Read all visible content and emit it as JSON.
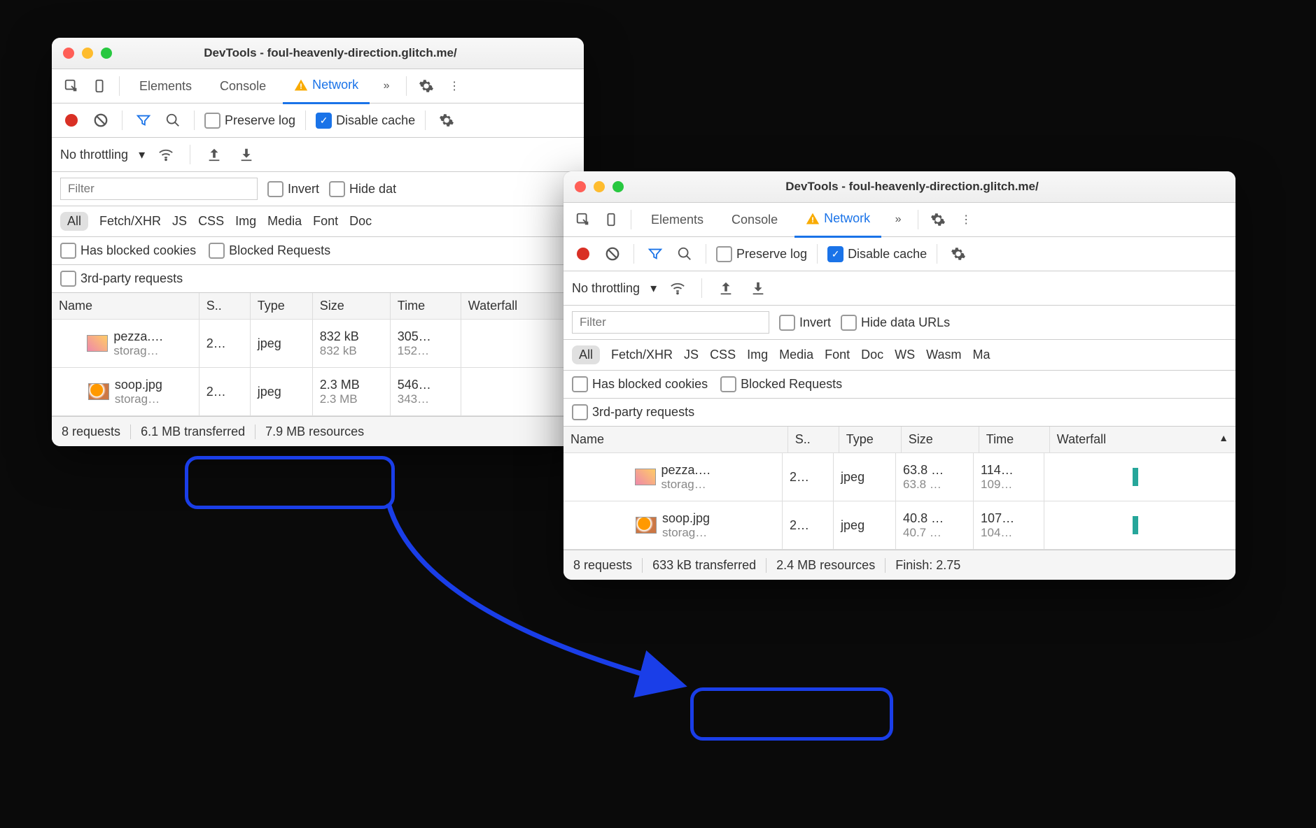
{
  "win1": {
    "title": "DevTools - foul-heavenly-direction.glitch.me/",
    "tabs": {
      "elements": "Elements",
      "console": "Console",
      "network": "Network"
    },
    "preserve_log": "Preserve log",
    "disable_cache": "Disable cache",
    "no_throttling": "No throttling",
    "filter_placeholder": "Filter",
    "invert": "Invert",
    "hide_data": "Hide dat",
    "types": {
      "all": "All",
      "fetch": "Fetch/XHR",
      "js": "JS",
      "css": "CSS",
      "img": "Img",
      "media": "Media",
      "font": "Font",
      "doc": "Doc"
    },
    "blocked_cookies": "Has blocked cookies",
    "blocked_requests": "Blocked Requests",
    "third_party": "3rd-party requests",
    "headers": {
      "name": "Name",
      "status": "S..",
      "type": "Type",
      "size": "Size",
      "time": "Time",
      "waterfall": "Waterfall"
    },
    "rows": [
      {
        "name": "pezza.…",
        "domain": "storag…",
        "status": "2…",
        "type": "jpeg",
        "size": "832 kB",
        "size2": "832 kB",
        "time": "305…",
        "time2": "152…"
      },
      {
        "name": "soop.jpg",
        "domain": "storag…",
        "status": "2…",
        "type": "jpeg",
        "size": "2.3 MB",
        "size2": "2.3 MB",
        "time": "546…",
        "time2": "343…"
      }
    ],
    "status": {
      "requests": "8 requests",
      "transferred": "6.1 MB transferred",
      "resources": "7.9 MB resources"
    }
  },
  "win2": {
    "title": "DevTools - foul-heavenly-direction.glitch.me/",
    "tabs": {
      "elements": "Elements",
      "console": "Console",
      "network": "Network"
    },
    "preserve_log": "Preserve log",
    "disable_cache": "Disable cache",
    "no_throttling": "No throttling",
    "filter_placeholder": "Filter",
    "invert": "Invert",
    "hide_data": "Hide data URLs",
    "types": {
      "all": "All",
      "fetch": "Fetch/XHR",
      "js": "JS",
      "css": "CSS",
      "img": "Img",
      "media": "Media",
      "font": "Font",
      "doc": "Doc",
      "ws": "WS",
      "wasm": "Wasm",
      "ma": "Ma"
    },
    "blocked_cookies": "Has blocked cookies",
    "blocked_requests": "Blocked Requests",
    "third_party": "3rd-party requests",
    "headers": {
      "name": "Name",
      "status": "S..",
      "type": "Type",
      "size": "Size",
      "time": "Time",
      "waterfall": "Waterfall"
    },
    "rows": [
      {
        "name": "pezza.…",
        "domain": "storag…",
        "status": "2…",
        "type": "jpeg",
        "size": "63.8 …",
        "size2": "63.8 …",
        "time": "114…",
        "time2": "109…"
      },
      {
        "name": "soop.jpg",
        "domain": "storag…",
        "status": "2…",
        "type": "jpeg",
        "size": "40.8 …",
        "size2": "40.7 …",
        "time": "107…",
        "time2": "104…"
      }
    ],
    "status": {
      "requests": "8 requests",
      "transferred": "633 kB transferred",
      "resources": "2.4 MB resources",
      "finish": "Finish: 2.75"
    }
  }
}
